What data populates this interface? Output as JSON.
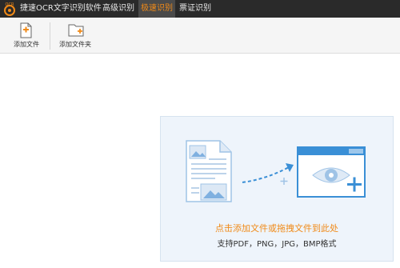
{
  "app": {
    "title": "捷速OCR文字识别软件",
    "logo_text": "OCR"
  },
  "tabs": [
    {
      "label": "高级识别",
      "active": false
    },
    {
      "label": "极速识别",
      "active": true
    },
    {
      "label": "票证识别",
      "active": false
    }
  ],
  "toolbar": {
    "add_file_label": "添加文件",
    "add_folder_label": "添加文件夹"
  },
  "drop_zone": {
    "main_text": "点击添加文件或拖拽文件到此处",
    "sub_text": "支持PDF，PNG，JPG，BMP格式"
  },
  "colors": {
    "accent": "#f08a18",
    "titlebar": "#2a2a2a",
    "drop_zone_bg": "#eef4fb",
    "illustration": "#3a8fd6"
  },
  "icons": [
    "ocr-logo-icon",
    "add-file-icon",
    "add-folder-icon",
    "document-image-icon",
    "dashed-arrow-icon",
    "eye-window-icon"
  ]
}
